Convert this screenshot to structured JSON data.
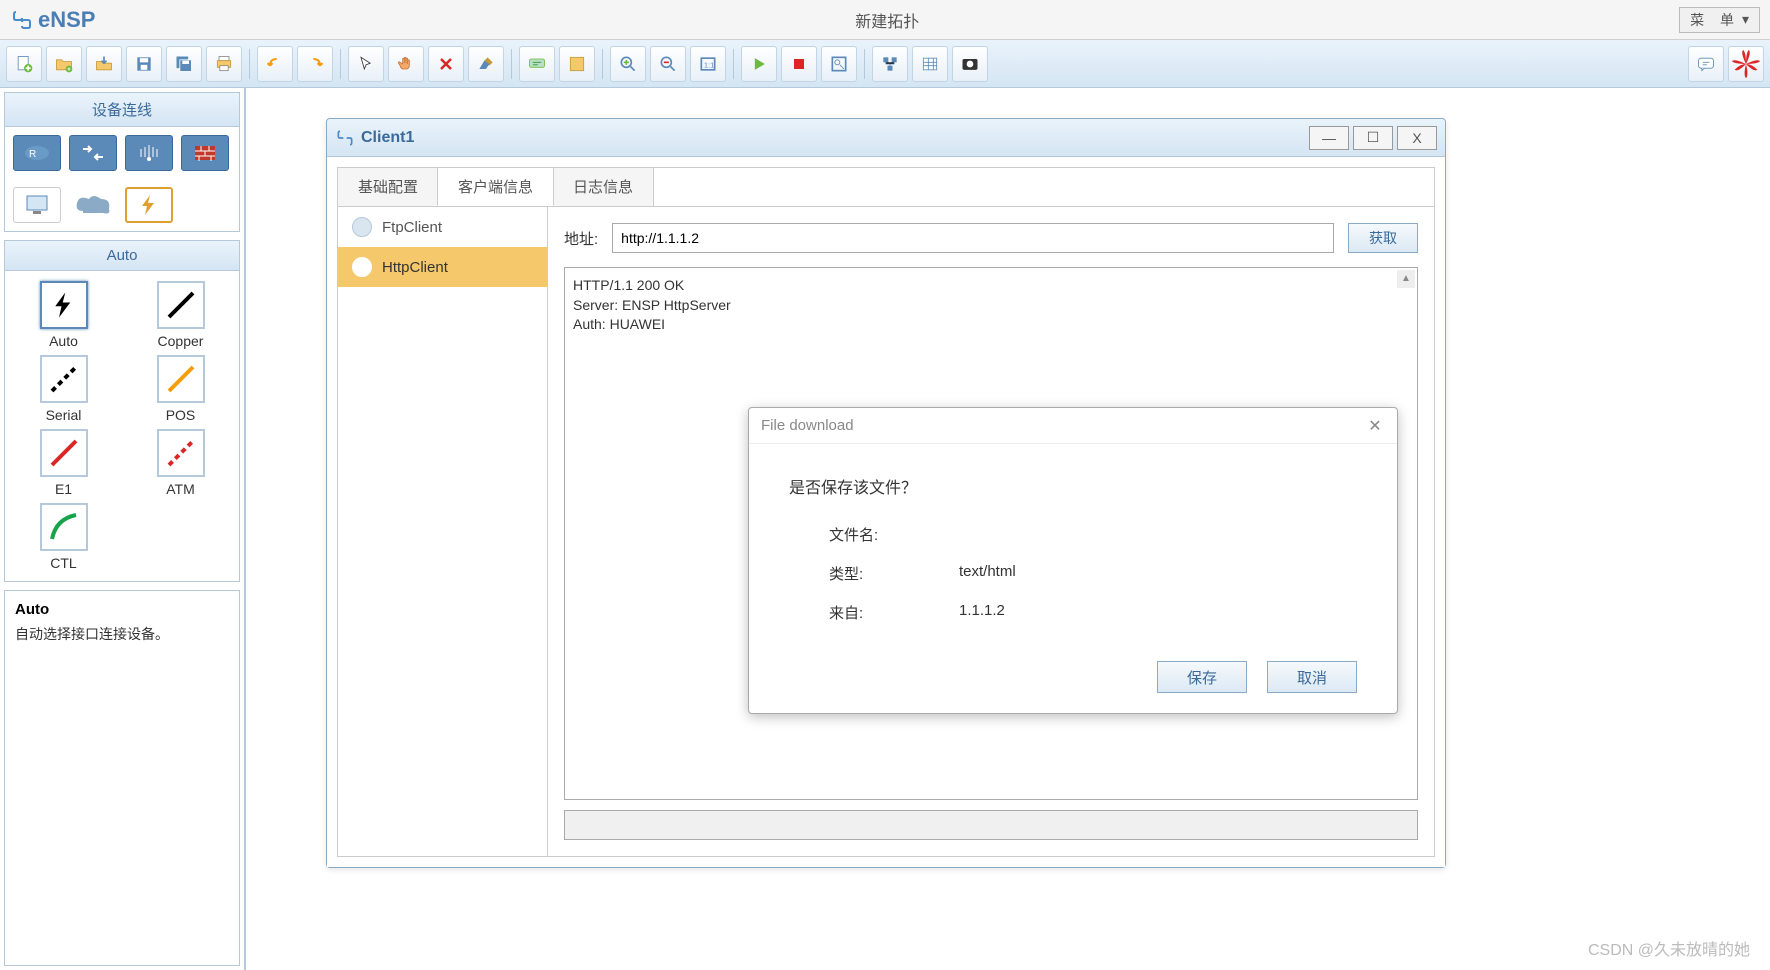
{
  "title": {
    "app": "eNSP",
    "doc": "新建拓扑",
    "menu": "菜  单"
  },
  "sidebar": {
    "header_devices": "设备连线",
    "header_auto": "Auto",
    "cables": [
      {
        "label": "Auto",
        "color": "#000",
        "style": "zap"
      },
      {
        "label": "Copper",
        "color": "#000",
        "style": "solid"
      },
      {
        "label": "Serial",
        "color": "#000",
        "style": "dash"
      },
      {
        "label": "POS",
        "color": "#f59e0b",
        "style": "solid"
      },
      {
        "label": "E1",
        "color": "#dc2626",
        "style": "solid"
      },
      {
        "label": "ATM",
        "color": "#dc2626",
        "style": "dash"
      },
      {
        "label": "CTL",
        "color": "#16a34a",
        "style": "curve"
      }
    ],
    "desc_title": "Auto",
    "desc_text": "自动选择接口连接设备。"
  },
  "client_win": {
    "title": "Client1",
    "tabs": [
      "基础配置",
      "客户端信息",
      "日志信息"
    ],
    "active_tab": 1,
    "clients": [
      {
        "name": "FtpClient",
        "selected": false
      },
      {
        "name": "HttpClient",
        "selected": true
      }
    ],
    "addr_label": "地址:",
    "addr_value": "http://1.1.1.2",
    "fetch_label": "获取",
    "response": "HTTP/1.1 200 OK\nServer: ENSP HttpServer\nAuth: HUAWEI"
  },
  "dialog": {
    "title": "File download",
    "question": "是否保存该文件？",
    "filename_label": "文件名:",
    "filename_value": "",
    "type_label": "类型:",
    "type_value": "text/html",
    "from_label": "来自:",
    "from_value": "1.1.1.2",
    "save": "保存",
    "cancel": "取消"
  },
  "watermark": "CSDN @久未放晴的她"
}
